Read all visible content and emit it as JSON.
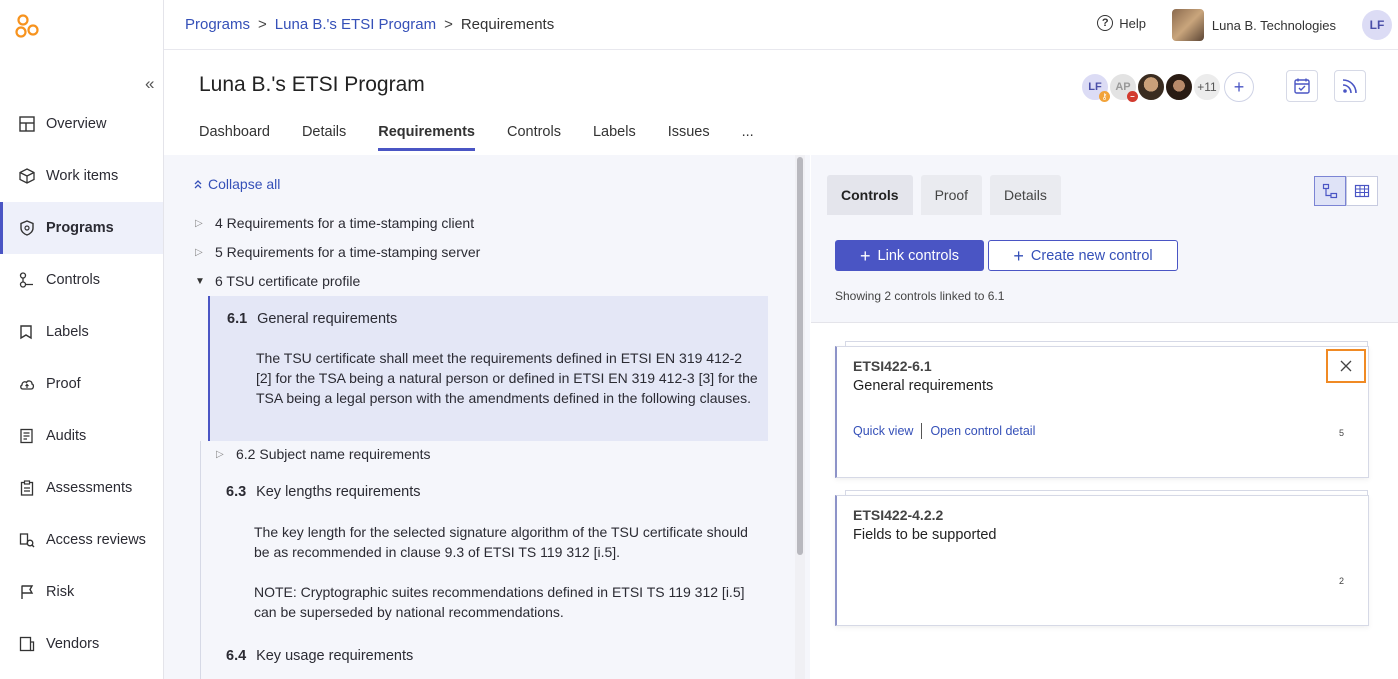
{
  "breadcrumb": {
    "programs": "Programs",
    "program": "Luna B.'s ETSI Program",
    "current": "Requirements",
    "separator": ">"
  },
  "header": {
    "help": "Help",
    "org_name": "Luna B. Technologies",
    "user_initials": "LF"
  },
  "sidebar": {
    "collapse_glyph": "«",
    "items": [
      {
        "label": "Overview",
        "icon": "overview-icon"
      },
      {
        "label": "Work items",
        "icon": "box-icon"
      },
      {
        "label": "Programs",
        "icon": "shield-icon"
      },
      {
        "label": "Controls",
        "icon": "controls-icon"
      },
      {
        "label": "Labels",
        "icon": "label-icon"
      },
      {
        "label": "Proof",
        "icon": "cloud-upload-icon"
      },
      {
        "label": "Audits",
        "icon": "audit-icon"
      },
      {
        "label": "Assessments",
        "icon": "clipboard-icon"
      },
      {
        "label": "Access reviews",
        "icon": "access-review-icon"
      },
      {
        "label": "Risk",
        "icon": "flag-icon"
      },
      {
        "label": "Vendors",
        "icon": "vendor-icon"
      }
    ],
    "active": "Programs"
  },
  "page": {
    "title": "Luna B.'s ETSI Program",
    "members": {
      "m1": "LF",
      "m2": "AP",
      "more": "+11",
      "add": "+"
    }
  },
  "tabs": [
    "Dashboard",
    "Details",
    "Requirements",
    "Controls",
    "Labels",
    "Issues",
    "..."
  ],
  "tree": {
    "collapse_all": "Collapse all",
    "rows": {
      "r4": "4 Requirements for a time-stamping client",
      "r5": "5 Requirements for a time-stamping server",
      "r6": "6 TSU certificate profile",
      "r62": "6.2 Subject name requirements"
    },
    "req61": {
      "num": "6.1",
      "title": "General requirements",
      "text": "The TSU certificate shall meet the requirements defined in ETSI EN 319 412-2 [2] for the TSA being a natural person or defined in ETSI EN 319 412-3 [3] for the TSA being a legal person with the amendments defined in the following clauses."
    },
    "req63": {
      "num": "6.3",
      "title": "Key lengths requirements",
      "text1": "The key length for the selected signature algorithm of the TSU certificate should be as recommended in clause 9.3 of ETSI TS 119 312 [i.5].",
      "text2": "NOTE: Cryptographic suites recommendations defined in ETSI TS 119 312 [i.5] can be superseded by national recommendations."
    },
    "req64": {
      "num": "6.4",
      "title": "Key usage requirements"
    }
  },
  "right": {
    "tabs": [
      "Controls",
      "Proof",
      "Details"
    ],
    "link_controls": "Link controls",
    "create_control": "Create new control",
    "showing": "Showing 2 controls linked to 6.1",
    "cards": [
      {
        "id": "ETSI422-6.1",
        "name": "General requirements",
        "quick_view": "Quick view",
        "open_detail": "Open control detail",
        "count": "5"
      },
      {
        "id": "ETSI422-4.2.2",
        "name": "Fields to be supported",
        "count": "2"
      }
    ]
  },
  "colors": {
    "accent": "#4a55c4",
    "link": "#3550b8",
    "highlight": "#f08a24",
    "logo": "#f7931e"
  }
}
